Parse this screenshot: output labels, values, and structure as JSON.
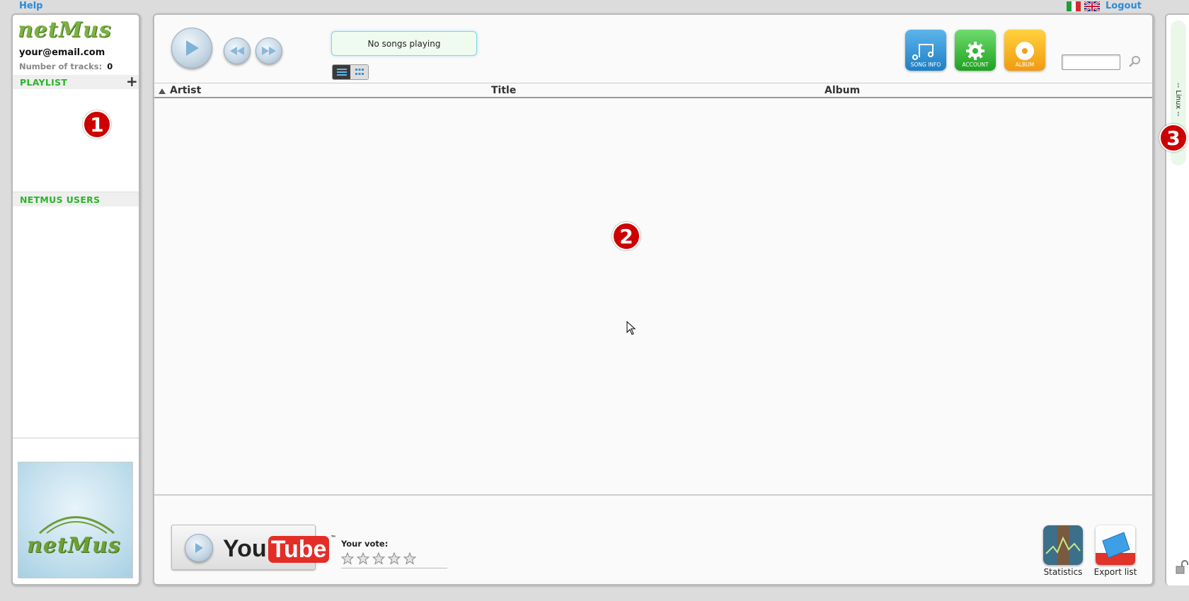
{
  "topbar": {
    "help": "Help",
    "logout": "Logout"
  },
  "sidebar": {
    "logo_text": "netMus",
    "email": "your@email.com",
    "tracks_label": "Number of tracks:",
    "tracks_count": "0",
    "playlist_header": "PLAYLIST",
    "add_symbol": "+",
    "users_header": "NETMUS USERS"
  },
  "player": {
    "status": "No songs playing",
    "icons": [
      {
        "label": "SONG INFO",
        "color": "#2a90d6"
      },
      {
        "label": "ACCOUNT",
        "color": "#33b533"
      },
      {
        "label": "ALBUM",
        "color": "#f0a019"
      }
    ]
  },
  "table": {
    "columns": [
      "Artist",
      "Title",
      "Album"
    ]
  },
  "footer": {
    "youtube_a": "You",
    "youtube_b": "Tube",
    "youtube_tm": "™",
    "vote_label": "Your vote:",
    "stars": 5,
    "statistics": "Statistics",
    "export": "Export list"
  },
  "right_tab": {
    "label": "-- Linux --"
  },
  "badges": [
    "1",
    "2",
    "3"
  ]
}
